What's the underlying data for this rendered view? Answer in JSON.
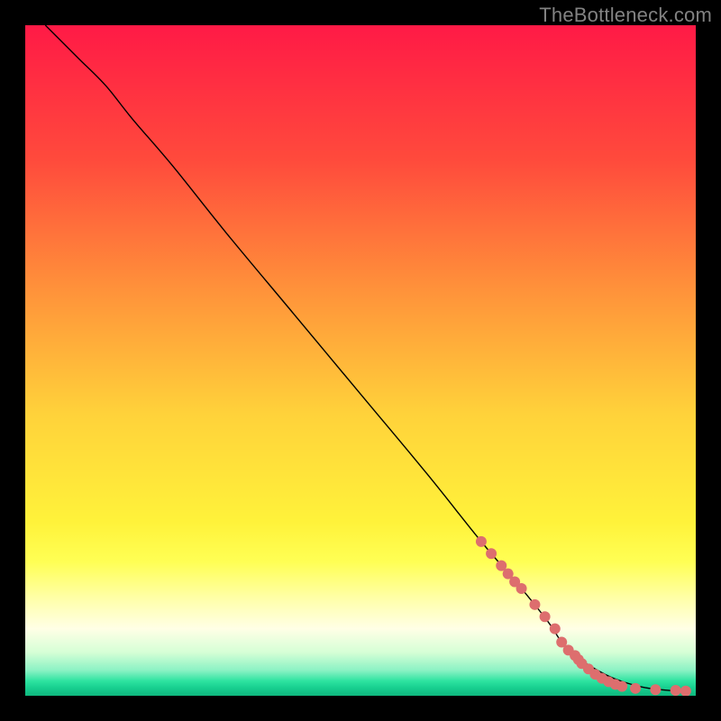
{
  "watermark": "TheBottleneck.com",
  "chart_data": {
    "type": "line",
    "title": "",
    "xlabel": "",
    "ylabel": "",
    "xlim": [
      0,
      100
    ],
    "ylim": [
      0,
      100
    ],
    "grid": false,
    "legend": false,
    "background_gradient": [
      {
        "stop": 0.0,
        "color": "#ff1a46"
      },
      {
        "stop": 0.2,
        "color": "#ff4a3c"
      },
      {
        "stop": 0.4,
        "color": "#ff943a"
      },
      {
        "stop": 0.58,
        "color": "#ffd23a"
      },
      {
        "stop": 0.74,
        "color": "#fff23a"
      },
      {
        "stop": 0.8,
        "color": "#ffff54"
      },
      {
        "stop": 0.86,
        "color": "#ffffb0"
      },
      {
        "stop": 0.9,
        "color": "#ffffe6"
      },
      {
        "stop": 0.935,
        "color": "#d6ffd6"
      },
      {
        "stop": 0.962,
        "color": "#8bf2c4"
      },
      {
        "stop": 0.978,
        "color": "#2de3a0"
      },
      {
        "stop": 0.988,
        "color": "#18cf90"
      },
      {
        "stop": 1.0,
        "color": "#0fb87e"
      }
    ],
    "series": [
      {
        "name": "curve",
        "type": "line",
        "color": "#000000",
        "width": 1.4,
        "x": [
          3,
          5,
          8,
          12,
          16,
          22,
          30,
          40,
          50,
          60,
          68,
          74,
          78,
          80,
          82,
          85,
          88,
          92,
          96,
          99
        ],
        "y": [
          100,
          98,
          95,
          91,
          86,
          79,
          69,
          57,
          45,
          33,
          23,
          16,
          11,
          8,
          6,
          4,
          2.5,
          1.3,
          0.8,
          0.7
        ]
      },
      {
        "name": "low-points",
        "type": "scatter",
        "color": "#dd6e6e",
        "radius": 6,
        "x": [
          68,
          69.5,
          71,
          72,
          73,
          74,
          76,
          77.5,
          79,
          80,
          81,
          82,
          82.5,
          83,
          84,
          85,
          86,
          87,
          88,
          89,
          91,
          94,
          97,
          98.5
        ],
        "y": [
          23,
          21.2,
          19.4,
          18.2,
          17,
          16,
          13.6,
          11.8,
          10,
          8,
          6.8,
          6,
          5.4,
          4.8,
          4,
          3.2,
          2.6,
          2.1,
          1.7,
          1.4,
          1.1,
          0.9,
          0.8,
          0.7
        ]
      }
    ]
  }
}
